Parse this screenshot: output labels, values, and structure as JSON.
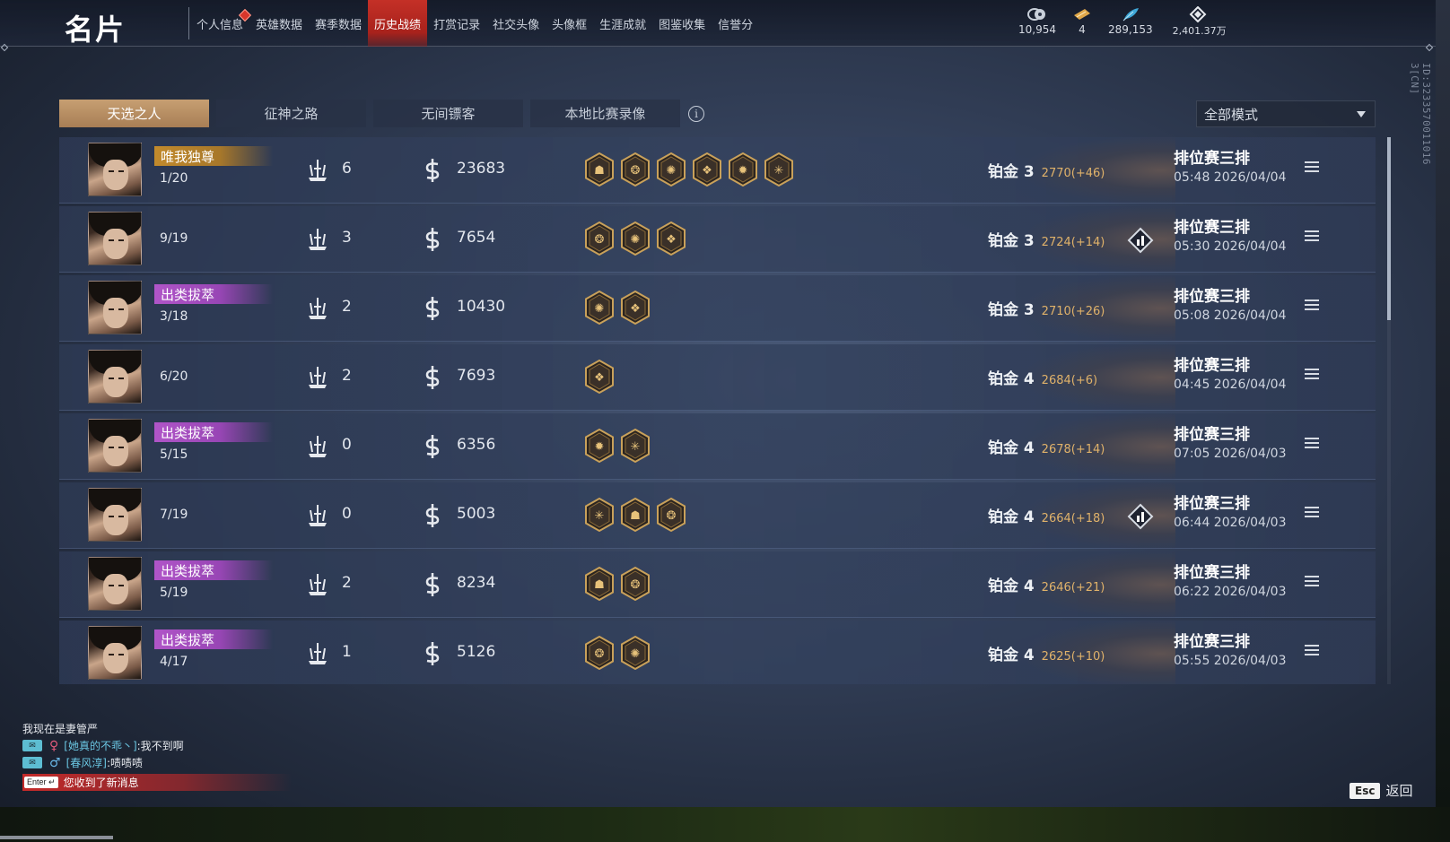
{
  "header": {
    "title": "名片",
    "nav": [
      {
        "label": "个人信息",
        "active": false,
        "badge": true
      },
      {
        "label": "英雄数据",
        "active": false
      },
      {
        "label": "赛季数据",
        "active": false
      },
      {
        "label": "历史战绩",
        "active": true
      },
      {
        "label": "打赏记录",
        "active": false
      },
      {
        "label": "社交头像",
        "active": false
      },
      {
        "label": "头像框",
        "active": false
      },
      {
        "label": "生涯成就",
        "active": false
      },
      {
        "label": "图鉴收集",
        "active": false
      },
      {
        "label": "信誉分",
        "active": false
      }
    ],
    "currencies": [
      {
        "icon": "coin-icon",
        "value": "10,954"
      },
      {
        "icon": "ticket-icon",
        "value": "4"
      },
      {
        "icon": "feather-icon",
        "value": "289,153"
      },
      {
        "icon": "gem-icon",
        "value": "2,401.37万"
      }
    ],
    "player_id": "ID:3233570011016 3[CN]"
  },
  "tabs": [
    {
      "label": "天选之人",
      "active": true
    },
    {
      "label": "征神之路",
      "active": false
    },
    {
      "label": "无间镖客",
      "active": false
    },
    {
      "label": "本地比赛录像",
      "active": false
    }
  ],
  "mode_select": {
    "value": "全部模式"
  },
  "matches": [
    {
      "avatar": "female",
      "title": "唯我独尊",
      "title_color": "gold",
      "kda": "1/20",
      "kills": "6",
      "damage": "23683",
      "badges": 6,
      "rank": "铂金 3",
      "points": "2770(+46)",
      "mvp": false,
      "mode": "排位赛三排",
      "time": "05:48 2026/04/04"
    },
    {
      "avatar": "male",
      "title": "",
      "title_color": "",
      "kda": "9/19",
      "kills": "3",
      "damage": "7654",
      "badges": 3,
      "rank": "铂金 3",
      "points": "2724(+14)",
      "mvp": true,
      "mode": "排位赛三排",
      "time": "05:30 2026/04/04"
    },
    {
      "avatar": "male",
      "title": "出类拔萃",
      "title_color": "purple",
      "kda": "3/18",
      "kills": "2",
      "damage": "10430",
      "badges": 2,
      "rank": "铂金 3",
      "points": "2710(+26)",
      "mvp": false,
      "mode": "排位赛三排",
      "time": "05:08 2026/04/04"
    },
    {
      "avatar": "male",
      "title": "",
      "title_color": "",
      "kda": "6/20",
      "kills": "2",
      "damage": "7693",
      "badges": 1,
      "rank": "铂金 4",
      "points": "2684(+6)",
      "mvp": false,
      "mode": "排位赛三排",
      "time": "04:45 2026/04/04"
    },
    {
      "avatar": "female",
      "title": "出类拔萃",
      "title_color": "purple",
      "kda": "5/15",
      "kills": "0",
      "damage": "6356",
      "badges": 2,
      "rank": "铂金 4",
      "points": "2678(+14)",
      "mvp": false,
      "mode": "排位赛三排",
      "time": "07:05 2026/04/03"
    },
    {
      "avatar": "male",
      "title": "",
      "title_color": "",
      "kda": "7/19",
      "kills": "0",
      "damage": "5003",
      "badges": 3,
      "rank": "铂金 4",
      "points": "2664(+18)",
      "mvp": true,
      "mode": "排位赛三排",
      "time": "06:44 2026/04/03"
    },
    {
      "avatar": "male",
      "title": "出类拔萃",
      "title_color": "purple",
      "kda": "5/19",
      "kills": "2",
      "damage": "8234",
      "badges": 2,
      "rank": "铂金 4",
      "points": "2646(+21)",
      "mvp": false,
      "mode": "排位赛三排",
      "time": "06:22 2026/04/03"
    },
    {
      "avatar": "male",
      "title": "出类拔萃",
      "title_color": "purple",
      "kda": "4/17",
      "kills": "1",
      "damage": "5126",
      "badges": 2,
      "rank": "铂金 4",
      "points": "2625(+10)",
      "mvp": false,
      "mode": "排位赛三排",
      "time": "05:55 2026/04/03"
    }
  ],
  "chat": {
    "line1": "我现在是妻管严",
    "line2_name": "[她真的不乖丶]",
    "line2_text": ":我不到啊",
    "line3_name": "[春风淳]",
    "line3_text": ":啧啧啧",
    "notice_key": "Enter",
    "notice": "您收到了新消息"
  },
  "footer": {
    "esc_key": "Esc",
    "back_label": "返回"
  },
  "colors": {
    "accent_red": "#c43027",
    "tab_active": "#b88d62",
    "points": "#e0b26a",
    "title_gold": "#c28a2c",
    "title_purple": "#b055c8"
  }
}
